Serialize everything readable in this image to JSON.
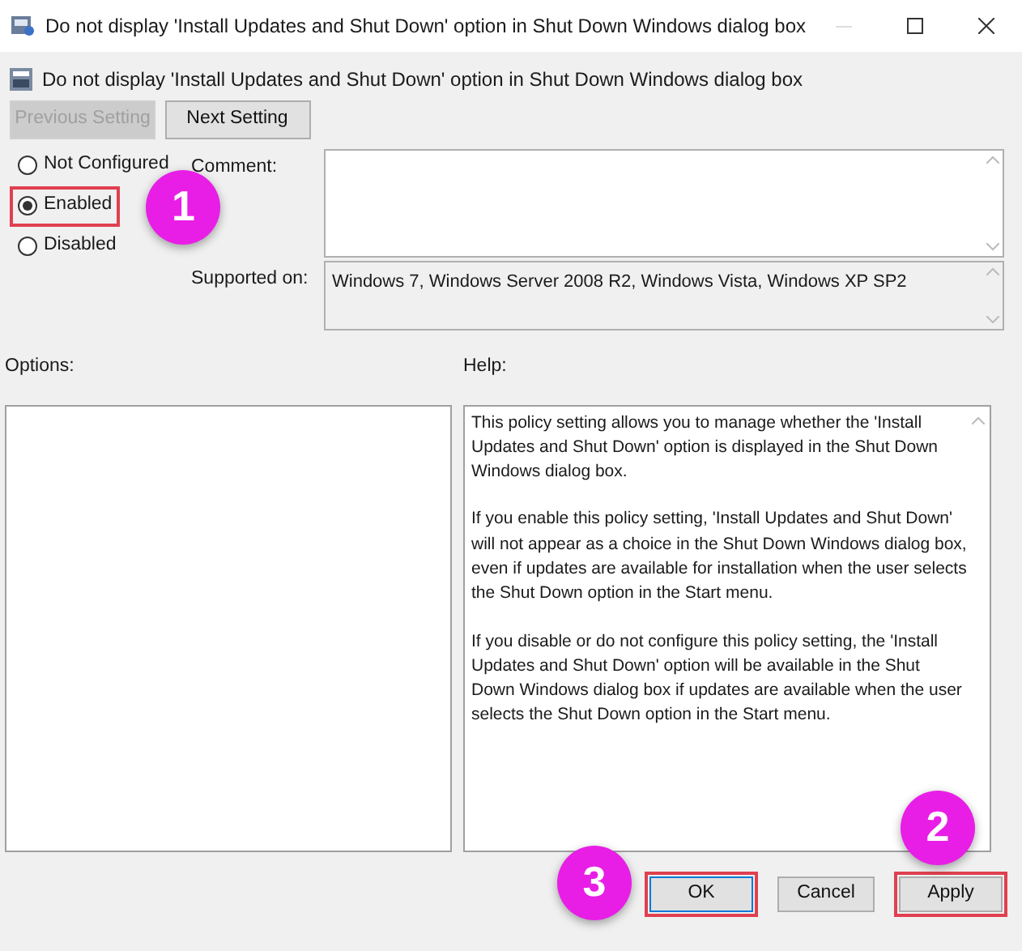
{
  "window": {
    "title": "Do not display 'Install Updates and Shut Down' option in Shut Down Windows dialog box"
  },
  "policy": {
    "title": "Do not display 'Install Updates and Shut Down' option in Shut Down Windows dialog box"
  },
  "nav_buttons": [
    {
      "label": "Previous Setting",
      "disabled": true
    },
    {
      "label": "Next Setting",
      "disabled": false
    }
  ],
  "state_options": [
    {
      "label": "Not Configured",
      "selected": false,
      "highlighted": false
    },
    {
      "label": "Enabled",
      "selected": true,
      "highlighted": true,
      "callout": "1"
    },
    {
      "label": "Disabled",
      "selected": false,
      "highlighted": false
    }
  ],
  "comment": {
    "label": "Comment:"
  },
  "supported_on": {
    "label": "Supported on:",
    "value": "Windows 7, Windows Server 2008 R2, Windows Vista, Windows XP SP2"
  },
  "options": {
    "label": "Options:"
  },
  "help": {
    "label": "Help:",
    "paragraphs": [
      "This policy setting allows you to manage whether the 'Install Updates and Shut Down' option is displayed in the Shut Down Windows dialog box.",
      "If you enable this policy setting, 'Install Updates and Shut Down' will not appear as a choice in the Shut Down Windows dialog box, even if updates are available for installation when the user selects the Shut Down option in the Start menu.",
      "If you disable or do not configure this policy setting, the 'Install Updates and Shut Down' option will be available in the Shut Down Windows dialog box if updates are available when the user selects the Shut Down option in the Start menu."
    ]
  },
  "dialog_buttons": [
    {
      "label": "OK",
      "highlighted": true,
      "focused": true,
      "callout": "3"
    },
    {
      "label": "Cancel",
      "highlighted": false,
      "focused": false
    },
    {
      "label": "Apply",
      "highlighted": true,
      "focused": false,
      "callout": "2"
    }
  ]
}
